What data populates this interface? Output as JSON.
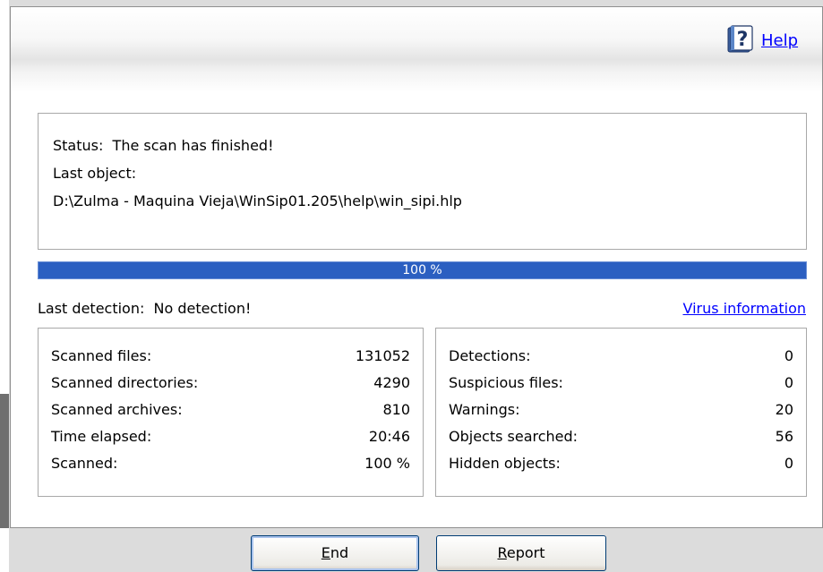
{
  "help": {
    "label": "Help",
    "icon": "help-book-icon"
  },
  "status": {
    "status_label": "Status:",
    "status_value": "The scan has finished!",
    "last_object_label": "Last object:",
    "last_object_path": "D:\\Zulma - Maquina Vieja\\WinSip01.205\\help\\win_sipi.hlp"
  },
  "progress": {
    "percent": 100,
    "text": "100 %"
  },
  "detection": {
    "label": "Last detection:",
    "value": "No detection!",
    "virus_link": "Virus information"
  },
  "stats_left": [
    {
      "label": "Scanned files:",
      "value": "131052"
    },
    {
      "label": "Scanned directories:",
      "value": "4290"
    },
    {
      "label": "Scanned archives:",
      "value": "810"
    },
    {
      "label": "Time elapsed:",
      "value": "20:46"
    },
    {
      "label": "Scanned:",
      "value": "100 %"
    }
  ],
  "stats_right": [
    {
      "label": "Detections:",
      "value": "0"
    },
    {
      "label": "Suspicious files:",
      "value": "0"
    },
    {
      "label": "Warnings:",
      "value": "20"
    },
    {
      "label": "Objects searched:",
      "value": "56"
    },
    {
      "label": "Hidden objects:",
      "value": "0"
    }
  ],
  "buttons": {
    "end": {
      "mnemonic": "E",
      "rest": "nd"
    },
    "report": {
      "mnemonic": "R",
      "rest": "eport"
    }
  },
  "colors": {
    "progress": "#2b5fc1",
    "link": "#0000ff"
  }
}
